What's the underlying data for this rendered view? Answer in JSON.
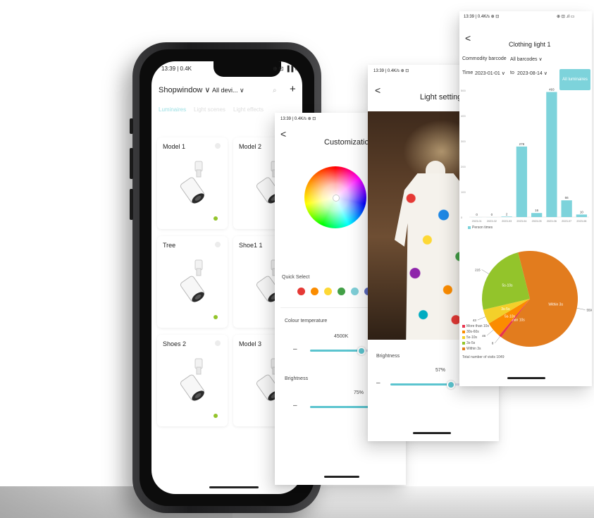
{
  "phone": {
    "status_time": "13:39 | 0.4K",
    "status_icons": "⊕ ⊡ ▐▐ ▭",
    "shop_dropdown": "Shopwindow ∨",
    "device_dropdown": "All devi... ∨",
    "add_label": "+",
    "tabs": [
      "Luminaires",
      "Light scenes",
      "Light effects"
    ],
    "cards": [
      {
        "label": "Model 1",
        "online": true
      },
      {
        "label": "Model 2",
        "online": false
      },
      {
        "label": "Tree",
        "online": true
      },
      {
        "label": "Shoe1 1",
        "online": false
      },
      {
        "label": "Shoes 2",
        "online": true
      },
      {
        "label": "Model 3",
        "online": false
      }
    ]
  },
  "customization": {
    "status_time": "13:39 | 0.4K/s ⊕ ⊡",
    "back": "<",
    "title": "Customization",
    "quick_select_label": "Quick Select",
    "quick_colors": [
      "#e53935",
      "#fb8c00",
      "#fdd835",
      "#43a047",
      "#7fcfd8",
      "#5c6bc0"
    ],
    "colour_temperature_label": "Colour temperature",
    "colour_temperature_value": "4500K",
    "brightness_label": "Brightness",
    "brightness_value": "75%",
    "brightness_fraction": 0.75,
    "colour_temperature_fraction": 0.55
  },
  "light_setting": {
    "status_time": "13:39 | 0.4K/s ⊕ ⊡",
    "back": "<",
    "title": "Light setting",
    "brightness_label": "Brightness",
    "brightness_value": "57%",
    "brightness_fraction": 0.57
  },
  "clothing": {
    "status_time": "13:39 | 0.4K/s ⊕ ⊡",
    "status_icons": "⊕ ⊡ .ıl ▭",
    "back": "<",
    "title": "Clothing light 1",
    "barcode_label": "Commodity barcode",
    "barcode_value": "All barcodes ∨",
    "time_label": "Time",
    "time_from": "2023-01-01 ∨",
    "time_to_label": "to",
    "time_to": "2023-08-14 ∨",
    "all_button": "All luminaires",
    "legend_person": "Person times",
    "pie_legend": [
      "More than 10s",
      "30s-60s",
      "5s-10s",
      "3s-5s",
      "Within 3s"
    ],
    "pie_legend_footer": "Total number of visits 1049"
  },
  "chart_data": [
    {
      "type": "bar",
      "title": "",
      "xlabel": "",
      "ylabel": "",
      "categories": [
        "2023-01",
        "2023-02",
        "2023-03",
        "2023-04",
        "2023-05",
        "2023-06",
        "2023-07",
        "2023-08"
      ],
      "values": [
        0,
        0,
        2,
        278,
        16,
        493,
        66,
        10
      ],
      "data_labels": [
        "0",
        "0",
        "2",
        "278",
        "16",
        "493",
        "66",
        "10"
      ],
      "ylim": [
        0,
        500
      ],
      "yticks": [
        "0",
        "100",
        "200",
        "300",
        "400",
        "500"
      ],
      "color": "#7dd3db",
      "legend": [
        "Person times"
      ]
    },
    {
      "type": "pie",
      "title": "",
      "slices": [
        {
          "label": "Within 3s",
          "value": 559,
          "color": "#e27c1e"
        },
        {
          "label": "More than 10s",
          "value": 8,
          "color": "#e8344e"
        },
        {
          "label": "5s-10s",
          "value": 46,
          "color": "#fb8c00"
        },
        {
          "label": "3s-5s",
          "value": 43,
          "color": "#f3d02a"
        },
        {
          "label": "5s-10s",
          "value": 215,
          "color": "#93c42b"
        }
      ],
      "data_labels": [
        "559",
        "8",
        "46",
        "43",
        "215"
      ]
    }
  ]
}
